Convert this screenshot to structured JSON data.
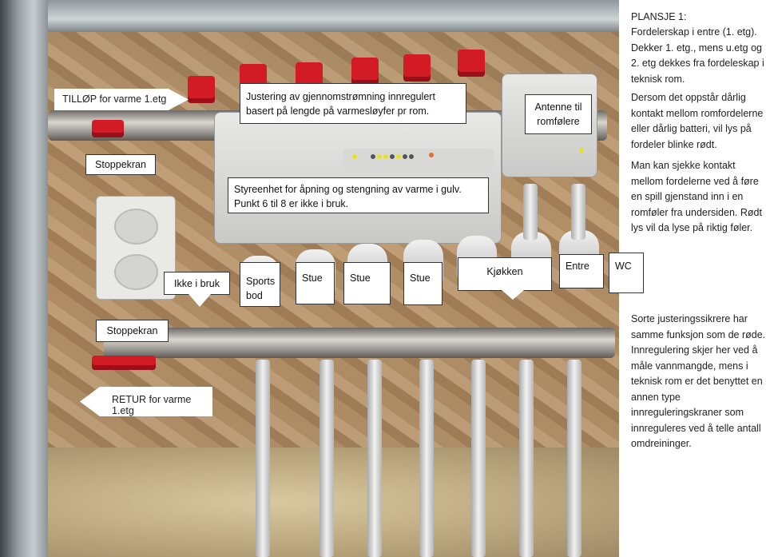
{
  "callouts": {
    "tillop": "TILLØP for varme 1.etg",
    "justering": "Justering av gjennomstrømning innregulert basert på lengde på varmesløyfer pr rom.",
    "antenne": "Antenne til romfølere",
    "stoppekran_top": "Stoppekran",
    "styreenhet": "Styreenhet for åpning og stengning av varme i gulv. Punkt 6 til 8 er ikke i bruk.",
    "ikke_i_bruk": "Ikke i bruk",
    "sports_bod": "Sports bod",
    "stue1": "Stue",
    "stue2": "Stue",
    "stue3": "Stue",
    "kjokken": "Kjøkken",
    "entre": "Entre",
    "wc": "WC",
    "stoppekran_bottom": "Stoppekran",
    "retur": "RETUR for varme 1.etg"
  },
  "side_text": {
    "title": "PLANSJE 1:",
    "intro": "Fordelerskap i entre (1. etg). Dekker 1. etg., mens u.etg og 2. etg dekkes fra fordeleskap i teknisk rom.",
    "para2": "Dersom det oppstår dårlig kontakt mellom romfordelerne eller dårlig batteri, vil lys på fordeler blinke rødt.",
    "para3": "Man kan sjekke kontakt mellom fordelerne ved å føre en spill gjenstand inn i en romføler fra undersiden. Rødt lys vil da lyse på riktig føler.",
    "para4": "Sorte justeringssikrere har samme funksjon som de røde. Innregulering skjer her ved å måle vannmangde, mens i teknisk rom er det benyttet en annen type innreguleringskraner som innreguleres ved å telle antall omdreininger."
  },
  "colors": {
    "valve_red": "#d21b25",
    "led_yellow": "#e8e020"
  }
}
